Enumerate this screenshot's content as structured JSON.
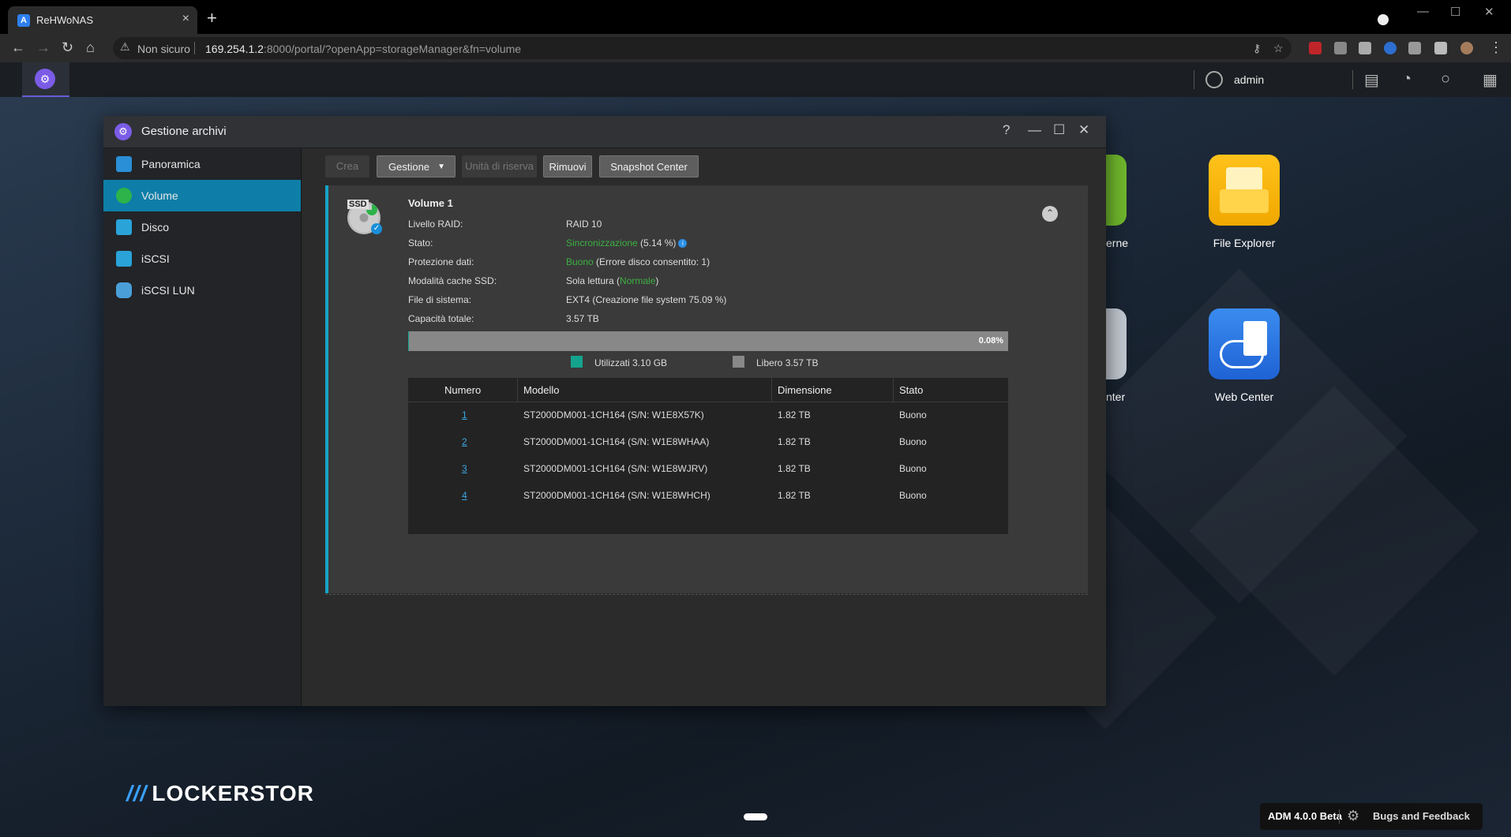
{
  "browser": {
    "tab_title": "ReHWoNAS",
    "tab_close": "×",
    "new_tab": "+",
    "security_label": "Non sicuro",
    "url_host": "169.254.1.2",
    "url_rest": ":8000/portal/?openApp=storageManager&fn=volume"
  },
  "adm": {
    "user": "admin"
  },
  "desktop": {
    "apps": [
      {
        "label": "File Explorer",
        "icon": "file-explorer-icon",
        "color": "#f6b40e"
      },
      {
        "label": "Web Center",
        "icon": "web-center-icon",
        "color": "#2e78e8"
      }
    ],
    "partial_labels": [
      "erne",
      "nter"
    ],
    "brand": "LOCKERSTOR",
    "version": "ADM 4.0.0 Beta",
    "feedback": "Bugs and Feedback"
  },
  "window": {
    "title": "Gestione archivi",
    "sidebar": [
      {
        "label": "Panoramica",
        "icon": "overview-icon",
        "active": false
      },
      {
        "label": "Volume",
        "icon": "volume-icon",
        "active": true
      },
      {
        "label": "Disco",
        "icon": "disk-icon",
        "active": false
      },
      {
        "label": "iSCSI",
        "icon": "iscsi-icon",
        "active": false
      },
      {
        "label": "iSCSI LUN",
        "icon": "iscsi-lun-icon",
        "active": false
      }
    ],
    "toolbar": {
      "create": "Crea",
      "manage": "Gestione",
      "spare": "Unità di riserva",
      "remove": "Rimuovi",
      "snapshot": "Snapshot Center"
    },
    "volume": {
      "name": "Volume 1",
      "ssd_badge": "SSD",
      "props": [
        {
          "label": "Livello RAID:",
          "value": "RAID 10"
        },
        {
          "label": "Stato:",
          "value_green": "Sincronizzazione",
          "value_rest": " (5.14 %)"
        },
        {
          "label": "Protezione dati:",
          "value_green": "Buono",
          "value_rest": " (Errore disco consentito: 1)"
        },
        {
          "label": "Modalità cache SSD:",
          "value_prefix": "Sola lettura (",
          "value_green": "Normale",
          "value_rest": ")"
        },
        {
          "label": "File di sistema:",
          "value": "EXT4 (Creazione file system 75.09 %)"
        },
        {
          "label": "Capacità totale:",
          "value": "3.57 TB"
        }
      ],
      "usage_percent_label": "0.08%",
      "usage_fraction": 0.0008,
      "legend_used": "Utilizzati 3.10 GB",
      "legend_free": "Libero 3.57 TB",
      "used_color": "#14a38c",
      "free_color": "#888888"
    },
    "disks": {
      "headers": [
        "Numero",
        "Modello",
        "Dimensione",
        "Stato"
      ],
      "rows": [
        {
          "num": "1",
          "model": "ST2000DM001-1CH164 (S/N: W1E8X57K)",
          "size": "1.82 TB",
          "status": "Buono"
        },
        {
          "num": "2",
          "model": "ST2000DM001-1CH164 (S/N: W1E8WHAA)",
          "size": "1.82 TB",
          "status": "Buono"
        },
        {
          "num": "3",
          "model": "ST2000DM001-1CH164 (S/N: W1E8WJRV)",
          "size": "1.82 TB",
          "status": "Buono"
        },
        {
          "num": "4",
          "model": "ST2000DM001-1CH164 (S/N: W1E8WHCH)",
          "size": "1.82 TB",
          "status": "Buono"
        }
      ]
    }
  }
}
